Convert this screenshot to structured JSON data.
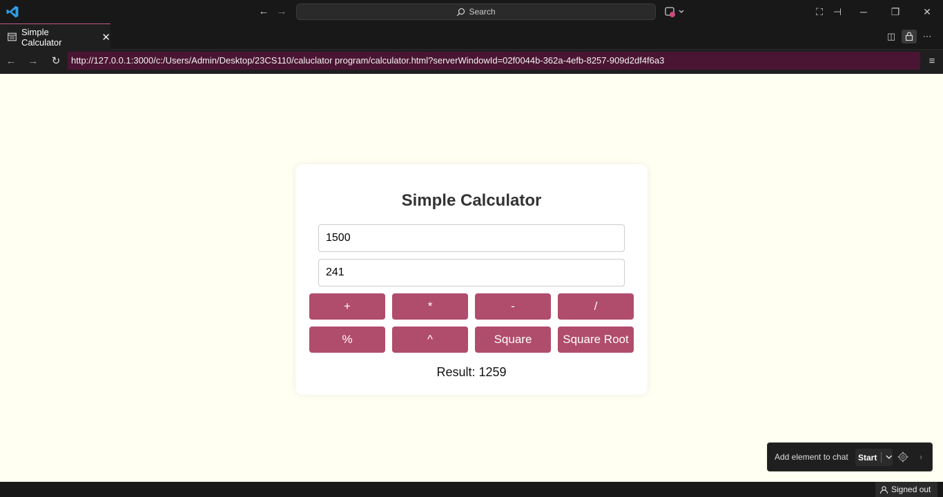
{
  "titlebar": {
    "search_label": "Search"
  },
  "tab": {
    "title": "Simple Calculator"
  },
  "address": {
    "url": "http://127.0.0.1:3000/c:/Users/Admin/Desktop/23CS110/caluclator program/calculator.html?serverWindowId=02f0044b-362a-4efb-8257-909d2df4f6a3"
  },
  "calculator": {
    "title": "Simple Calculator",
    "input1_value": "1500",
    "input2_value": "241",
    "buttons": {
      "add": "+",
      "multiply": "*",
      "subtract": "-",
      "divide": "/",
      "modulo": "%",
      "power": "^",
      "square": "Square",
      "sqrt": "Square Root"
    },
    "result": "Result: 1259"
  },
  "chat_popup": {
    "label": "Add element to chat",
    "start_label": "Start"
  },
  "statusbar": {
    "account_label": "Signed out"
  },
  "colors": {
    "button": "#b04c6c",
    "page_background": "#fffff2",
    "url_bar": "#4a1533",
    "accent": "#007acc"
  }
}
